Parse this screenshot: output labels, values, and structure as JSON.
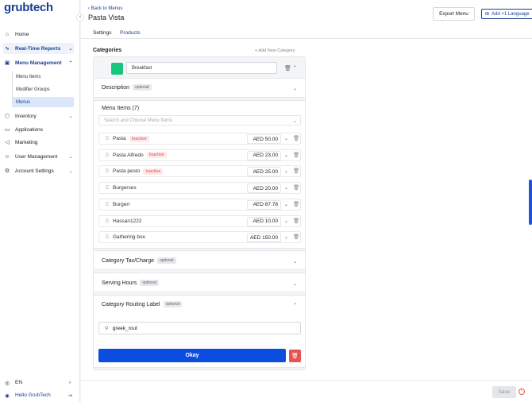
{
  "brand": {
    "logo": "grubtech"
  },
  "sidebar": {
    "collapse_icon": "‹",
    "items": [
      {
        "label": "Home"
      },
      {
        "label": "Real-Time Reports"
      },
      {
        "label": "Menu Management"
      },
      {
        "label": "Inventory"
      },
      {
        "label": "Applications"
      },
      {
        "label": "Marketing"
      },
      {
        "label": "User Management"
      },
      {
        "label": "Account Settings"
      }
    ],
    "menu_sub": [
      {
        "label": "Menu Items"
      },
      {
        "label": "Modifier Groups"
      },
      {
        "label": "Menus"
      }
    ],
    "language": "EN",
    "greeting": "Hello GrubTech"
  },
  "header": {
    "back_label": "Back to Menus",
    "title": "Pasta Vista",
    "export_label": "Export Menu",
    "language_label": "Add +1 Language"
  },
  "tabs": [
    {
      "label": "Settings"
    },
    {
      "label": "Products"
    }
  ],
  "categories": {
    "title": "Categories",
    "add_label": "+ Add New Category",
    "name_value": "Breakfast",
    "color": "#16c77b",
    "description": {
      "title": "Description",
      "optional": "optional"
    },
    "menu_items_title": "Menu Items (7)",
    "search_placeholder": "Search and Choose Menu Items",
    "inactive_label": "Inactive",
    "items": [
      {
        "name": "Pasta",
        "price": "AED 50.00",
        "inactive": true
      },
      {
        "name": "Pasta Alfredo",
        "price": "AED 23.00",
        "inactive": true
      },
      {
        "name": "Pasta pesto",
        "price": "AED 25.00",
        "inactive": true
      },
      {
        "name": "Burgerses",
        "price": "AED 20.00",
        "inactive": false
      },
      {
        "name": "Burgerr",
        "price": "AED 87.78",
        "inactive": false
      },
      {
        "name": "Hassan1222",
        "price": "AED 10.00",
        "inactive": false
      },
      {
        "name": "Gathering box",
        "price": "AED 150.00",
        "inactive": false
      }
    ],
    "tax": {
      "title": "Category Tax/Charge",
      "optional": "optional"
    },
    "serving": {
      "title": "Serving Hours",
      "optional": "optional"
    },
    "routing": {
      "title": "Category Routing Label",
      "optional": "optional",
      "value": "greek_rout"
    },
    "okay_label": "Okay"
  },
  "footer": {
    "save_label": "Save"
  },
  "colors": {
    "primary": "#0b4de1",
    "brand": "#1b3f8f",
    "danger": "#e65353"
  }
}
